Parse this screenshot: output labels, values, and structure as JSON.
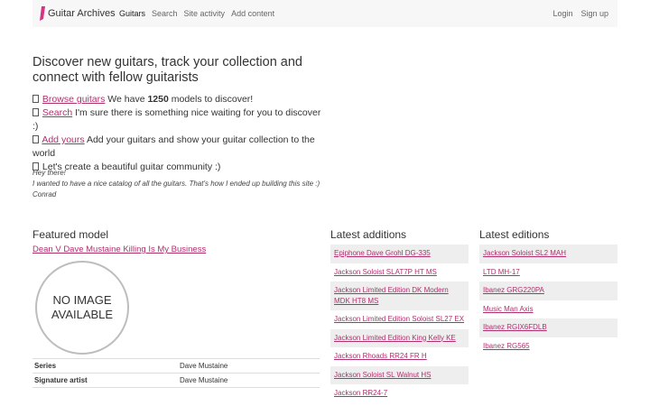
{
  "nav": {
    "brand": "Guitar Archives",
    "links": [
      "Guitars",
      "Search",
      "Site activity",
      "Add content"
    ],
    "right": [
      "Login",
      "Sign up"
    ]
  },
  "hero": {
    "title": "Discover new guitars, track your collection and connect with fellow guitarists",
    "line1": {
      "link": "Browse guitars",
      "pre": " We have ",
      "count": "1250",
      "post": " models to discover!"
    },
    "line2": {
      "link": "Search",
      "text": " I'm sure there is something nice waiting for you to discover :)"
    },
    "line3": {
      "link": "Add yours",
      "text": " Add your guitars and show your guitar collection to the world"
    },
    "line4": {
      "text": " Let's create a beautiful guitar community :)"
    }
  },
  "note": {
    "line1": "Hey there!",
    "line2": "I wanted to have a nice catalog of all the guitars. That's how I ended up building this site :)",
    "line3": "Conrad"
  },
  "featured": {
    "title": "Featured model",
    "model": "Dean V Dave Mustaine Killing Is My Business",
    "image_text": "NO IMAGE\nAVAILABLE",
    "props": [
      {
        "key": "Series",
        "value": "Dave Mustaine"
      },
      {
        "key": "Signature artist",
        "value": "Dave Mustaine"
      }
    ]
  },
  "additions": {
    "title": "Latest additions",
    "items": [
      "Epiphone Dave Grohl DG-335",
      "Jackson Soloist SLAT7P HT MS",
      "Jackson Limited Edition DK Modern MDK HT8 MS",
      "Jackson Limited Edition Soloist SL27 EX",
      "Jackson Limited Edition King Kelly KE",
      "Jackson Rhoads RR24 FR H",
      "Jackson Soloist SL Walnut HS",
      "Jackson RR24-7"
    ]
  },
  "editions": {
    "title": "Latest editions",
    "items": [
      "Jackson Soloist SL2 MAH",
      "LTD MH-17",
      "Ibanez GRG220PA",
      "Music Man Axis",
      "Ibanez RGIX6FDLB",
      "Ibanez RG565"
    ]
  },
  "colors": {
    "accent": "#b0306e",
    "navbar_bg": "#f7f7f7",
    "stripe": "#eeeeee"
  }
}
